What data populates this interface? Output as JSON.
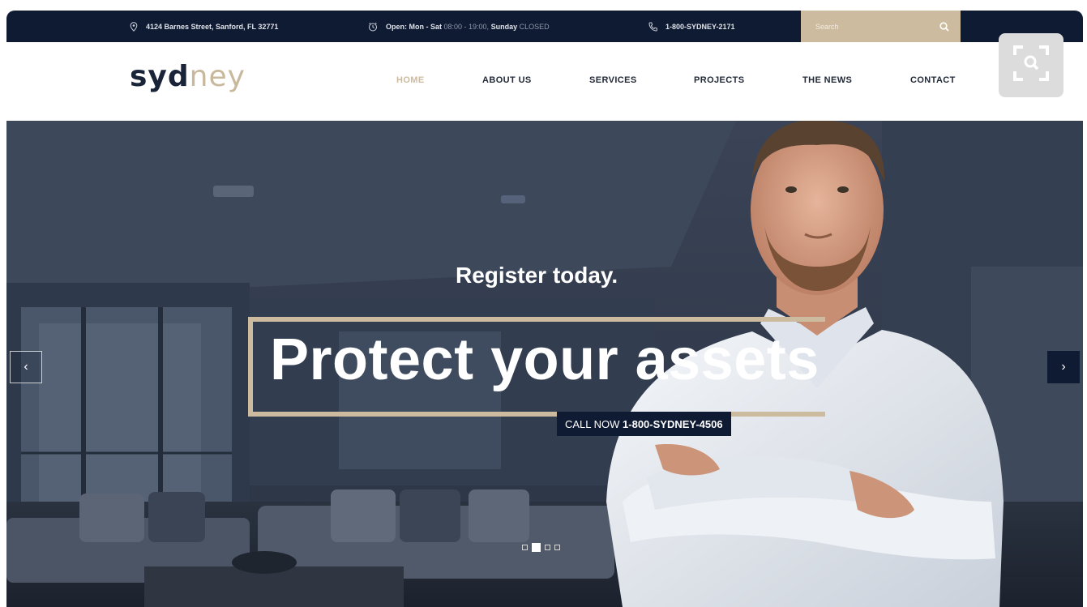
{
  "topbar": {
    "address": "4124 Barnes Street, Sanford, FL 32771",
    "hours_open": "Open: Mon - Sat",
    "hours_time": "08:00 - 19:00,",
    "hours_sunday": "Sunday",
    "hours_closed": "CLOSED",
    "phone": "1-800-SYDNEY-2171",
    "search_placeholder": "Search"
  },
  "header": {
    "logo_part1": "syd",
    "logo_part2": "ney",
    "nav": [
      {
        "label": "HOME",
        "active": true
      },
      {
        "label": "ABOUT US",
        "active": false
      },
      {
        "label": "SERVICES",
        "active": false
      },
      {
        "label": "PROJECTS",
        "active": false
      },
      {
        "label": "THE NEWS",
        "active": false
      },
      {
        "label": "CONTACT",
        "active": false
      }
    ]
  },
  "hero": {
    "subtitle": "Register today.",
    "title": "Protect your assets",
    "cta_prefix": "CALL NOW ",
    "cta_phone": "1-800-SYDNEY-4506",
    "prev_arrow": "‹",
    "next_arrow": "›",
    "slides_count": 4,
    "active_slide": 2
  },
  "colors": {
    "navy": "#0f1b33",
    "gold": "#cdbb9f",
    "white": "#ffffff"
  },
  "icons": [
    "location-icon",
    "clock-icon",
    "phone-icon",
    "search-icon",
    "zoom-search-icon",
    "chevron-left-icon",
    "chevron-right-icon"
  ]
}
